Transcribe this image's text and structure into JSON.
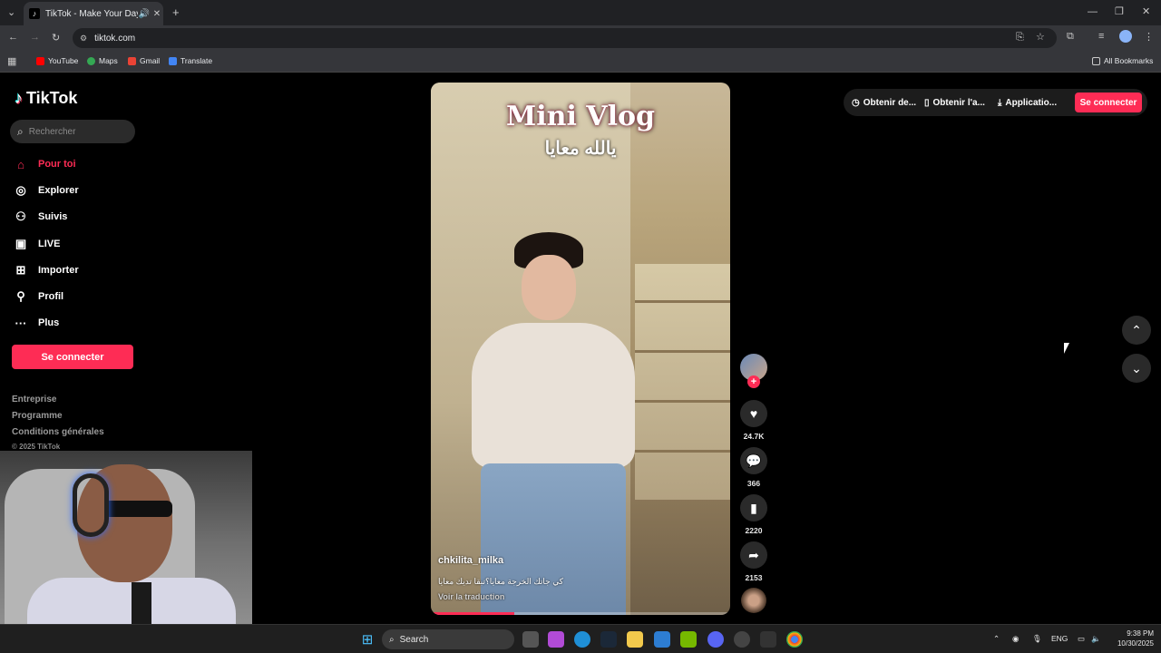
{
  "browser": {
    "tab_title": "TikTok - Make Your Day",
    "url": "tiktok.com",
    "bookmarks": [
      "YouTube",
      "Maps",
      "Gmail",
      "Translate"
    ],
    "all_bookmarks": "All Bookmarks"
  },
  "tiktok": {
    "logo": "TikTok",
    "search_placeholder": "Rechercher",
    "nav": [
      "Pour toi",
      "Explorer",
      "Suivis",
      "LIVE",
      "Importer",
      "Profil",
      "Plus"
    ],
    "connect_left": "Se connecter",
    "footer_links": [
      "Entreprise",
      "Programme",
      "Conditions générales"
    ],
    "copyright": "© 2025 TikTok",
    "top_buttons": [
      "Obtenir de...",
      "Obtenir l'a...",
      "Applicatio..."
    ],
    "connect_right": "Se connecter"
  },
  "video": {
    "title": "Mini Vlog",
    "subtitle": "يالله معايا",
    "username": "chkilita_milka",
    "caption": "كي جاتك الخرجة معايا؟تبقا تديك معايا",
    "translate": "Voir la traduction",
    "progress": 0.28
  },
  "actions": {
    "likes": "24.7K",
    "comments": "366",
    "saves": "2220",
    "shares": "2153"
  },
  "taskbar": {
    "search": "Search",
    "lang": "ENG",
    "time": "9:38 PM",
    "date": "10/30/2025"
  },
  "colors": {
    "accent": "#fe2c55",
    "chrome_dark": "#202124",
    "chrome_mid": "#35363a"
  }
}
